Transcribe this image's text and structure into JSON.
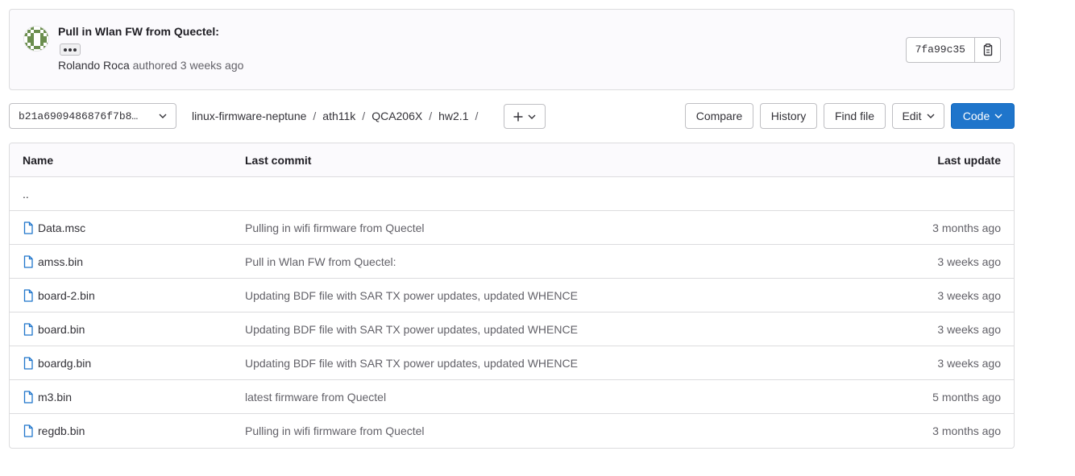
{
  "commit": {
    "title": "Pull in Wlan FW from Quectel:",
    "author": "Rolando Roca",
    "authored_text": "authored",
    "time": "3 weeks ago",
    "sha": "7fa99c35"
  },
  "toolbar": {
    "branch": "b21a6909486876f7b8…",
    "breadcrumb": [
      "linux-firmware-neptune",
      "ath11k",
      "QCA206X",
      "hw2.1"
    ],
    "compare_label": "Compare",
    "history_label": "History",
    "find_file_label": "Find file",
    "edit_label": "Edit",
    "code_label": "Code"
  },
  "table": {
    "headers": {
      "name": "Name",
      "last_commit": "Last commit",
      "last_update": "Last update"
    },
    "parent": "..",
    "rows": [
      {
        "name": "Data.msc",
        "commit": "Pulling in wifi firmware from Quectel",
        "updated": "3 months ago"
      },
      {
        "name": "amss.bin",
        "commit": "Pull in Wlan FW from Quectel:",
        "updated": "3 weeks ago"
      },
      {
        "name": "board-2.bin",
        "commit": "Updating BDF file with SAR TX power updates, updated WHENCE",
        "updated": "3 weeks ago"
      },
      {
        "name": "board.bin",
        "commit": "Updating BDF file with SAR TX power updates, updated WHENCE",
        "updated": "3 weeks ago"
      },
      {
        "name": "boardg.bin",
        "commit": "Updating BDF file with SAR TX power updates, updated WHENCE",
        "updated": "3 weeks ago"
      },
      {
        "name": "m3.bin",
        "commit": "latest firmware from Quectel",
        "updated": "5 months ago"
      },
      {
        "name": "regdb.bin",
        "commit": "Pulling in wifi firmware from Quectel",
        "updated": "3 months ago"
      }
    ]
  },
  "colors": {
    "primary": "#1f75cb",
    "link_icon": "#1f75cb",
    "avatar": "#6b8e4e"
  }
}
